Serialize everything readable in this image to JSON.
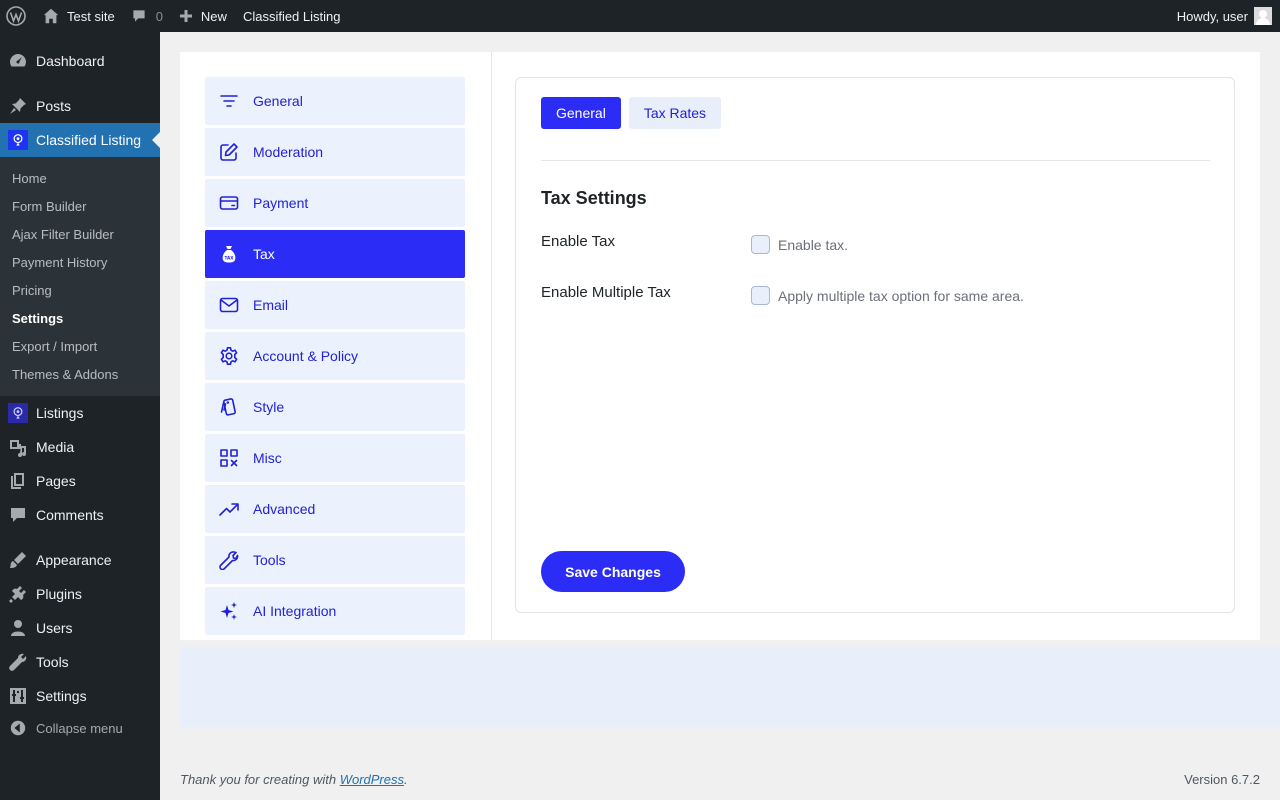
{
  "admin_bar": {
    "site_name": "Test site",
    "comment_count": "0",
    "new_label": "New",
    "plugin_link": "Classified Listing",
    "greeting": "Howdy, user"
  },
  "sidebar": {
    "items": [
      {
        "label": "Dashboard",
        "icon": "dashboard-icon"
      },
      {
        "label": "Posts",
        "icon": "pin-icon"
      },
      {
        "label": "Classified Listing",
        "icon": "classified-listing-icon"
      },
      {
        "label": "Listings",
        "icon": "classified-listing-icon"
      },
      {
        "label": "Media",
        "icon": "media-icon"
      },
      {
        "label": "Pages",
        "icon": "pages-icon"
      },
      {
        "label": "Comments",
        "icon": "comment-icon"
      },
      {
        "label": "Appearance",
        "icon": "brush-icon"
      },
      {
        "label": "Plugins",
        "icon": "plug-icon"
      },
      {
        "label": "Users",
        "icon": "user-icon"
      },
      {
        "label": "Tools",
        "icon": "wrench-icon"
      },
      {
        "label": "Settings",
        "icon": "sliders-icon"
      }
    ],
    "submenu": [
      "Home",
      "Form Builder",
      "Ajax Filter Builder",
      "Payment History",
      "Pricing",
      "Settings",
      "Export / Import",
      "Themes & Addons"
    ],
    "submenu_current": "Settings",
    "collapse_label": "Collapse menu"
  },
  "settings_nav": [
    {
      "label": "General",
      "icon": "filter-lines-icon"
    },
    {
      "label": "Moderation",
      "icon": "edit-icon"
    },
    {
      "label": "Payment",
      "icon": "credit-card-icon"
    },
    {
      "label": "Tax",
      "icon": "tax-bag-icon"
    },
    {
      "label": "Email",
      "icon": "envelope-icon"
    },
    {
      "label": "Account & Policy",
      "icon": "gear-icon"
    },
    {
      "label": "Style",
      "icon": "palette-cards-icon"
    },
    {
      "label": "Misc",
      "icon": "grid-icon"
    },
    {
      "label": "Advanced",
      "icon": "trending-up-icon"
    },
    {
      "label": "Tools",
      "icon": "wrench-icon"
    },
    {
      "label": "AI Integration",
      "icon": "sparkles-icon"
    }
  ],
  "settings_nav_active": "Tax",
  "panel": {
    "tabs": [
      "General",
      "Tax Rates"
    ],
    "active_tab": "General",
    "section_title": "Tax Settings",
    "fields": [
      {
        "label": "Enable Tax",
        "checkbox_text": "Enable tax.",
        "checked": false
      },
      {
        "label": "Enable Multiple Tax",
        "checkbox_text": "Apply multiple tax option for same area.",
        "checked": false
      }
    ],
    "save_label": "Save Changes"
  },
  "footer": {
    "thanks_prefix": "Thank you for creating with ",
    "thanks_link": "WordPress",
    "thanks_suffix": ".",
    "version": "Version 6.7.2"
  },
  "colors": {
    "accent": "#2b2cf5",
    "nav_bg": "#ecf2fd",
    "wp_admin_dark": "#1d2327",
    "wp_blue": "#2271b1"
  }
}
